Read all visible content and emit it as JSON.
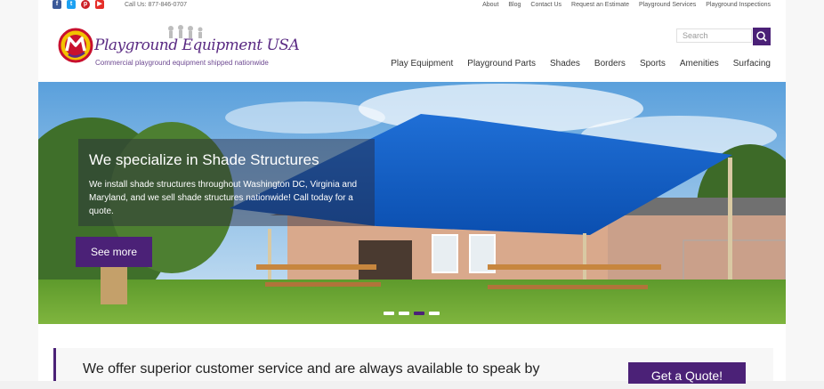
{
  "topbar": {
    "social": [
      {
        "name": "facebook-icon",
        "glyph": "f",
        "color": "#3b5998"
      },
      {
        "name": "twitter-icon",
        "glyph": "t",
        "color": "#1da1f2"
      },
      {
        "name": "pinterest-icon",
        "glyph": "p",
        "color": "#cb2027"
      },
      {
        "name": "youtube-icon",
        "glyph": "▶",
        "color": "#e52d27"
      }
    ],
    "phone": "Call Us: 877-846-0707",
    "links": [
      "About",
      "Blog",
      "Contact Us",
      "Request an Estimate",
      "Playground Services",
      "Playground Inspections"
    ]
  },
  "header": {
    "brand": "Playground Equipment USA",
    "tagline": "Commercial playground equipment shipped nationwide",
    "search_placeholder": "Search"
  },
  "nav": [
    "Play Equipment",
    "Playground Parts",
    "Shades",
    "Borders",
    "Sports",
    "Amenities",
    "Surfacing"
  ],
  "hero": {
    "title": "We specialize in Shade Structures",
    "text": "We install shade structures throughout Washington DC, Virginia and Maryland, and we sell shade structures nationwide! Call today for a quote.",
    "button": "See more",
    "slides": 4,
    "active_slide": 3
  },
  "cta": {
    "text": "We offer superior customer service and are always available to speak by",
    "button": "Get a Quote!"
  },
  "colors": {
    "accent": "#4b2177"
  }
}
